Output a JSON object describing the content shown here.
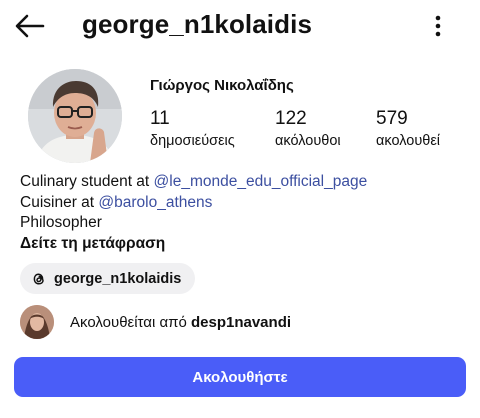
{
  "header": {
    "username": "george_n1kolaidis",
    "back_icon": "arrow-left-icon",
    "more_icon": "kebab-menu-icon"
  },
  "profile": {
    "display_name": "Γιώργος Νικολαΐδης",
    "stats": {
      "posts": {
        "count": "11",
        "label": "δημοσιεύσεις"
      },
      "followers": {
        "count": "122",
        "label": "ακόλουθοι"
      },
      "following": {
        "count": "579",
        "label": "ακολουθεί"
      }
    }
  },
  "bio": {
    "line1_text": "Culinary student at ",
    "line1_mention": "@le_monde_edu_official_page",
    "line2_text": "Cuisiner at ",
    "line2_mention": "@barolo_athens",
    "line3_text": "Philosopher",
    "translate_label": "Δείτε τη μετάφραση"
  },
  "threads": {
    "handle": "george_n1kolaidis",
    "icon": "threads-icon"
  },
  "followed_by": {
    "prefix": "Ακολουθείται από ",
    "user": "desp1navandi"
  },
  "actions": {
    "follow_label": "Ακολουθήστε"
  },
  "colors": {
    "accent": "#4a5df8",
    "mention": "#3c4fa0",
    "chip_bg": "#f0f0f2"
  }
}
